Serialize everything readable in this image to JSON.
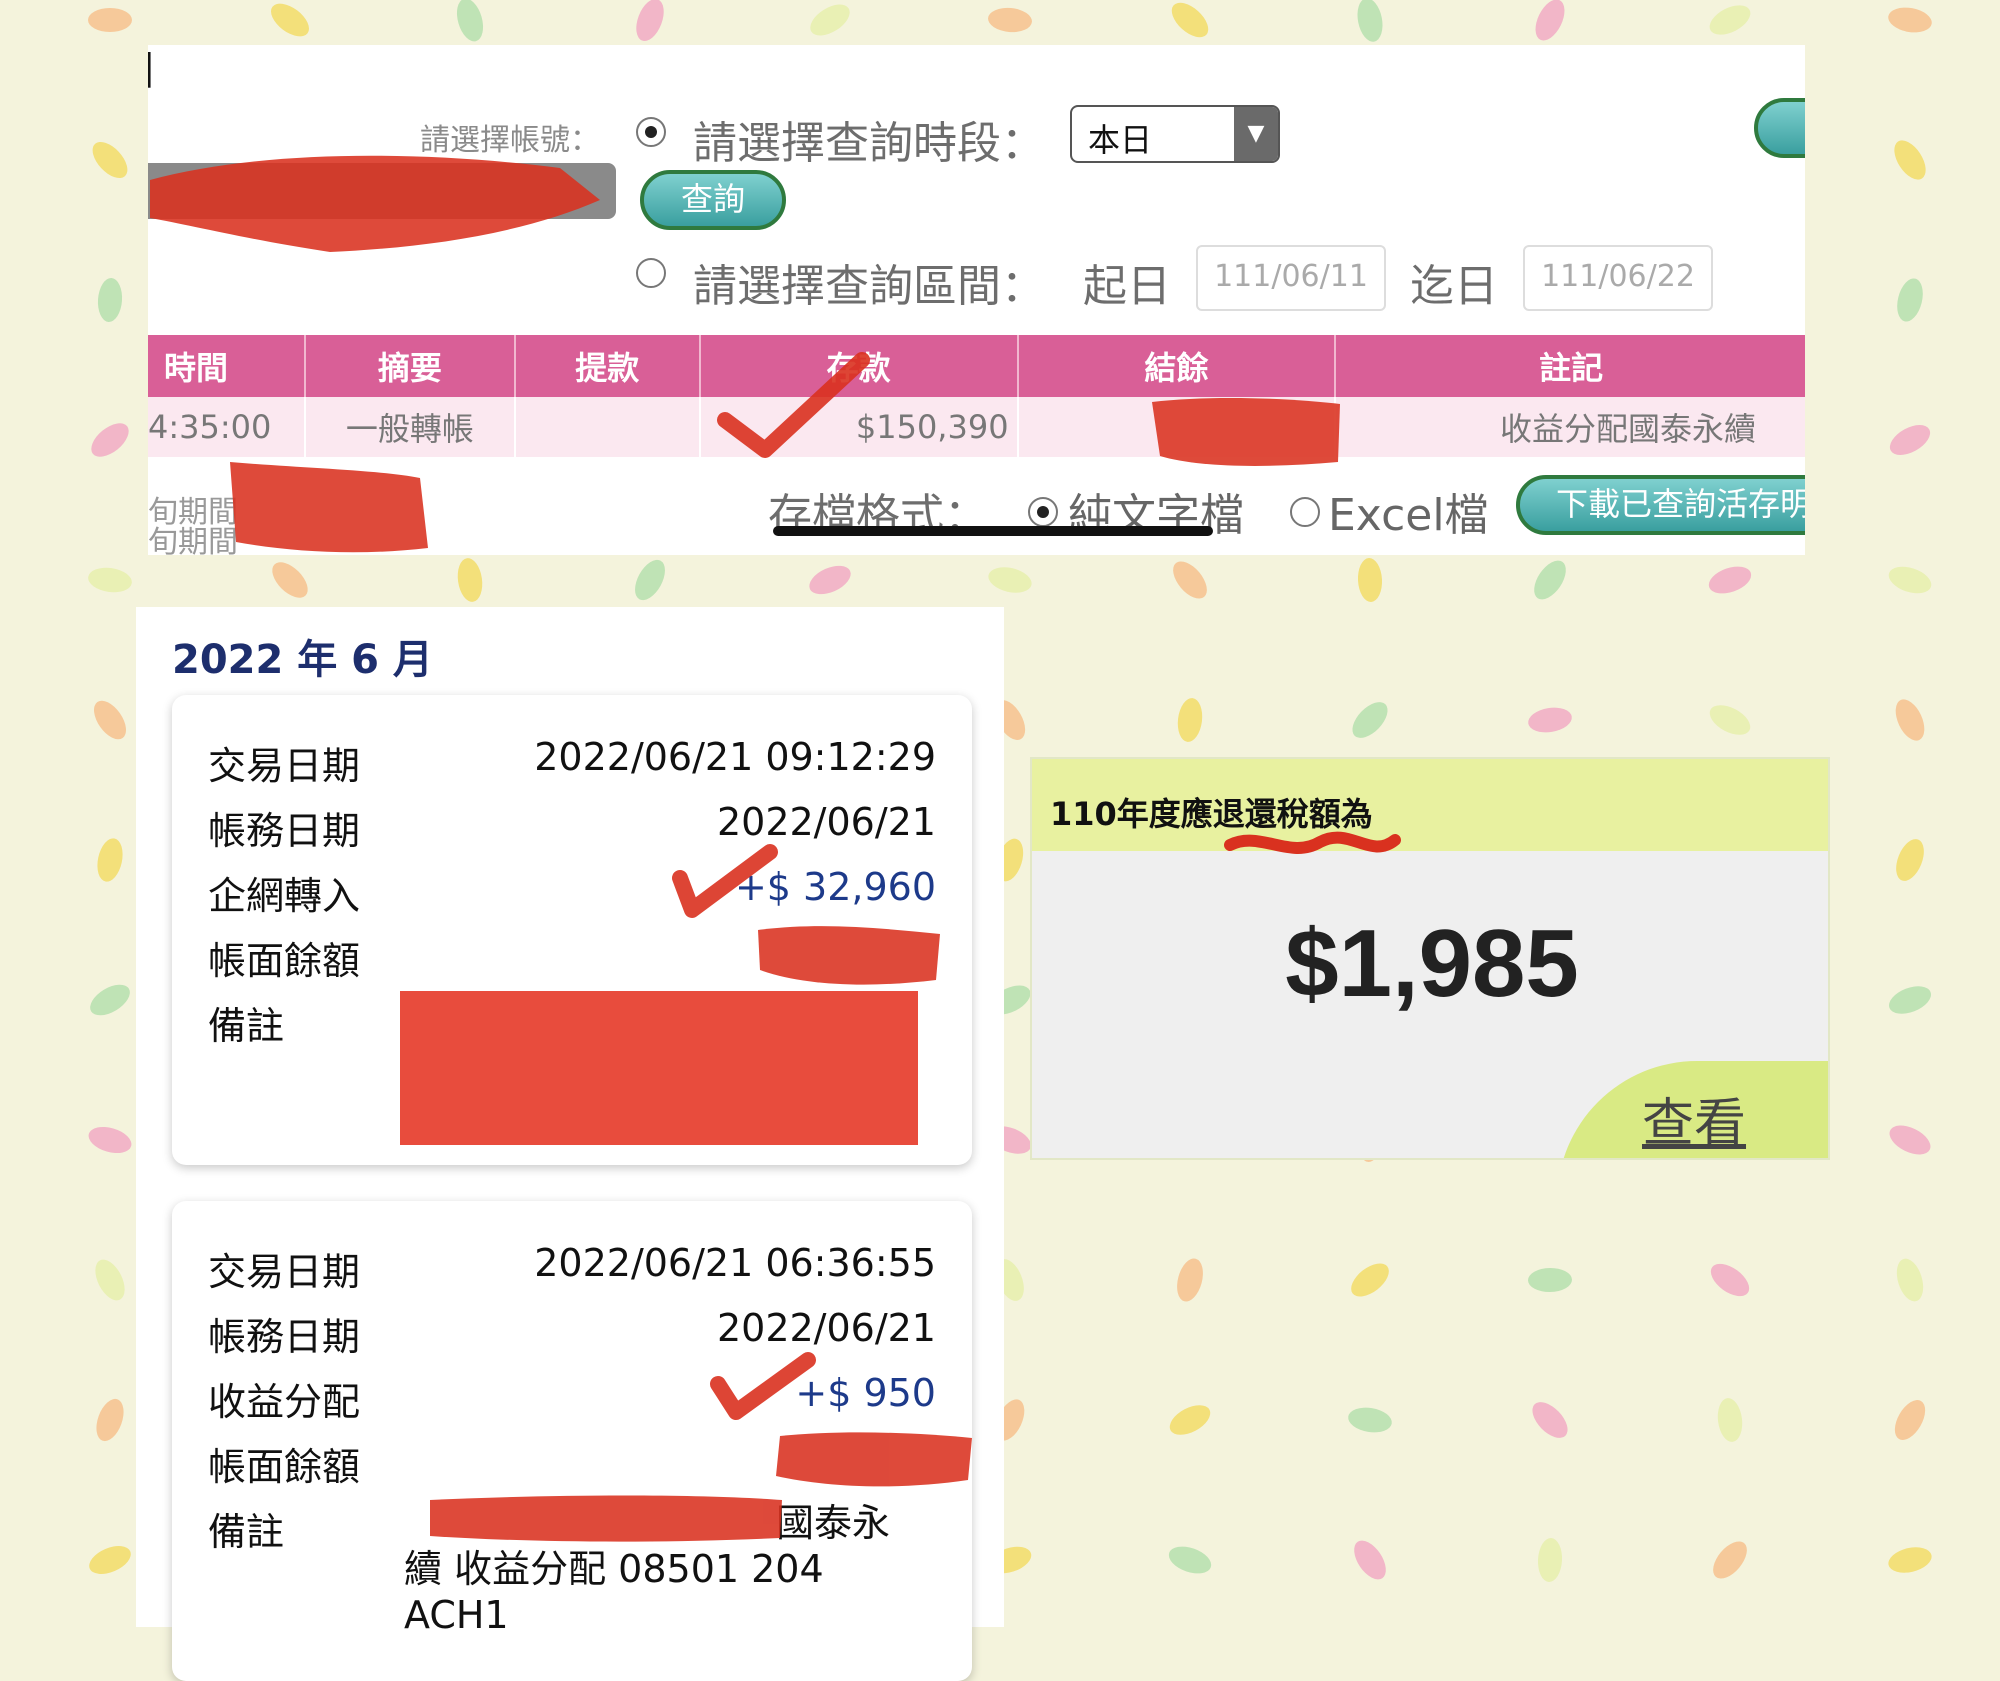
{
  "colors": {
    "background": "#f4f3dc",
    "table_header": "#d95f97",
    "table_row": "#fbe8f0",
    "button_teal": "#3a9f9f",
    "month_title": "#1d2e6d",
    "tax_header": "#e8f1a0",
    "view_button": "#d9ea84",
    "redaction": "#e53a28"
  },
  "query_panel": {
    "account_label": "請選擇帳號：",
    "period_label": "請選擇查詢時段：",
    "period_selected": "本日",
    "query_button": "查詢",
    "range_label": "請選擇查詢區間：",
    "start_label": "起日",
    "start_placeholder": "111/06/11",
    "end_label": "迄日",
    "end_placeholder": "111/06/22",
    "table": {
      "headers": [
        "時間",
        "摘要",
        "提款",
        "存款",
        "結餘",
        "註記"
      ],
      "rows": [
        {
          "time": "4:35:00",
          "summary": "一般轉帳",
          "withdraw": "",
          "deposit": "$150,390",
          "balance": "",
          "note": "收益分配國泰永續"
        }
      ]
    },
    "period_total_1": "旬期間",
    "period_total_2": "旬期間",
    "save_format_label": "存檔格式：",
    "format_text": "純文字檔",
    "format_excel": "Excel檔",
    "download_button": "下載已查詢活存明"
  },
  "statement": {
    "month_title": "2022 年 6 月",
    "cards": [
      {
        "rows": [
          {
            "label": "交易日期",
            "value": "2022/06/21 09:12:29"
          },
          {
            "label": "帳務日期",
            "value": "2022/06/21"
          },
          {
            "label": "企網轉入",
            "value": "+$ 32,960"
          },
          {
            "label": "帳面餘額",
            "value": ""
          },
          {
            "label": "備註",
            "value": ""
          }
        ]
      },
      {
        "rows": [
          {
            "label": "交易日期",
            "value": "2022/06/21 06:36:55"
          },
          {
            "label": "帳務日期",
            "value": "2022/06/21"
          },
          {
            "label": "收益分配",
            "value": "+$ 950"
          },
          {
            "label": "帳面餘額",
            "value": ""
          },
          {
            "label": "備註",
            "value": ""
          }
        ],
        "note_line1": "國泰永",
        "note_line2": "續 收益分配 08501 204",
        "note_line3": "ACH1"
      }
    ]
  },
  "tax_card": {
    "title": "110年度應退還稅額為",
    "amount": "$1,985",
    "view_button": "查看"
  }
}
